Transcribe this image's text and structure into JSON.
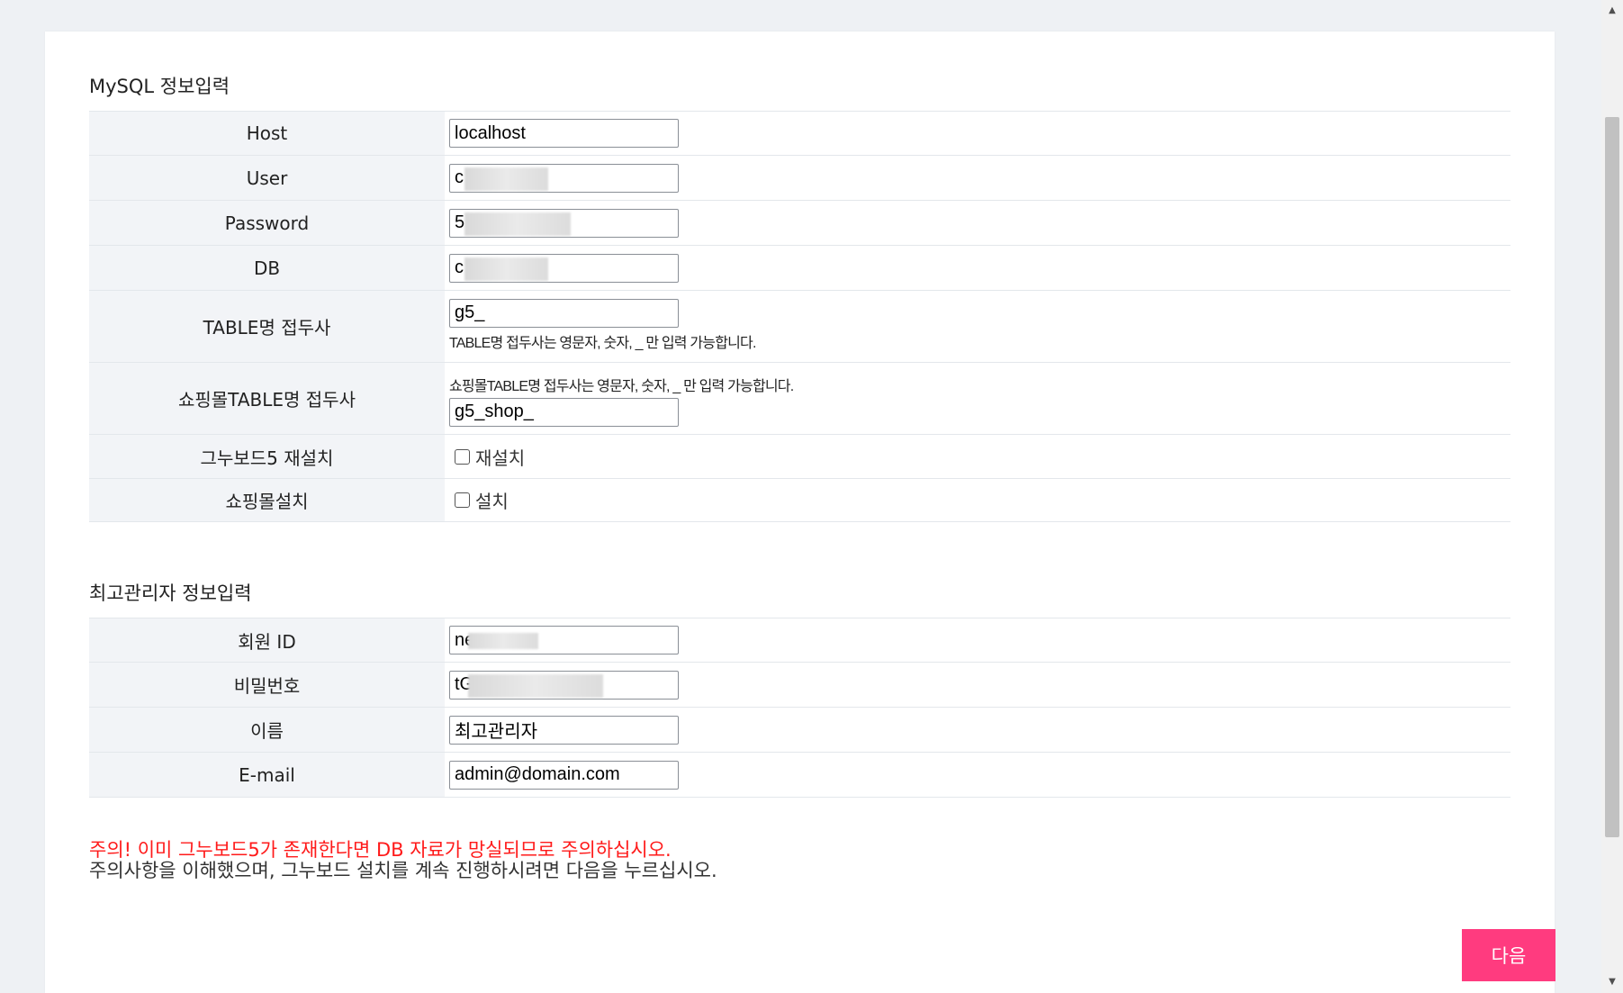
{
  "mysql_section": {
    "title": "MySQL 정보입력",
    "host_label": "Host",
    "host_value": "localhost",
    "user_label": "User",
    "user_value": "c",
    "password_label": "Password",
    "password_value": "5",
    "db_label": "DB",
    "db_value": "c",
    "table_prefix_label": "TABLE명 접두사",
    "table_prefix_value": "g5_",
    "table_prefix_help": "TABLE명 접두사는 영문자, 숫자, _ 만 입력 가능합니다.",
    "shop_prefix_label": "쇼핑몰TABLE명 접두사",
    "shop_prefix_help": "쇼핑몰TABLE명 접두사는 영문자, 숫자, _ 만 입력 가능합니다.",
    "shop_prefix_value": "g5_shop_",
    "reinstall_label": "그누보드5 재설치",
    "reinstall_checkbox": "재설치",
    "shop_install_label": "쇼핑몰설치",
    "shop_install_checkbox": "설치"
  },
  "admin_section": {
    "title": "최고관리자 정보입력",
    "id_label": "회원 ID",
    "id_value": "ne",
    "password_label": "비밀번호",
    "password_value": "tG",
    "name_label": "이름",
    "name_value": "최고관리자",
    "email_label": "E-mail",
    "email_value": "admin@domain.com"
  },
  "notice": {
    "warning": "주의! 이미 그누보드5가 존재한다면 DB 자료가 망실되므로 주의하십시오.",
    "instruction": "주의사항을 이해했으며, 그누보드 설치를 계속 진행하시려면 다음을 누르십시오."
  },
  "next_button": "다음",
  "colors": {
    "accent": "#ff3b7f",
    "warning": "#ff1a1a",
    "header_cell": "#f2f4f7"
  }
}
